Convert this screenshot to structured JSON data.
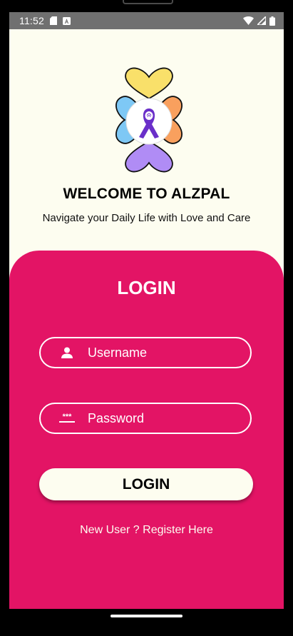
{
  "status_bar": {
    "time": "11:52",
    "left_icons": [
      "sd-card-icon",
      "app-notification-icon"
    ],
    "right_icons": [
      "wifi-icon",
      "signal-icon",
      "battery-icon"
    ]
  },
  "header": {
    "logo_icon": "flower-ribbon-logo-icon",
    "title": "WELCOME TO ALZPAL",
    "tagline": "Navigate your Daily Life with Love and Care"
  },
  "login": {
    "heading": "LOGIN",
    "username": {
      "placeholder": "Username",
      "icon": "person-icon"
    },
    "password": {
      "placeholder": "Password",
      "icon": "password-dots-icon"
    },
    "submit_label": "LOGIN",
    "register_link": "New User ? Register Here"
  },
  "colors": {
    "background": "#fdfdf0",
    "panel": "#e31465",
    "status_bar": "#707070",
    "petal_yellow": "#f9e06a",
    "petal_blue": "#7ec8f5",
    "petal_orange": "#f9a05e",
    "petal_purple": "#b08cf5",
    "ribbon": "#6a2fc9"
  }
}
